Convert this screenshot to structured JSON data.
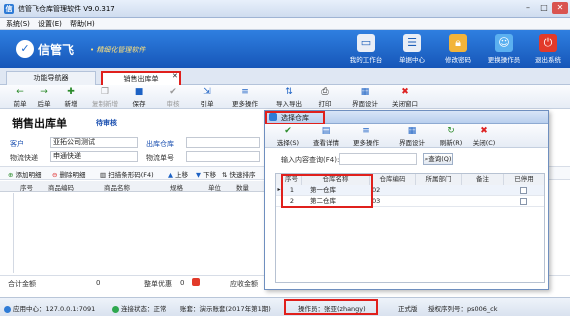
{
  "window": {
    "title": "信管飞仓库管理软件 V9.0.317"
  },
  "menu": [
    "系统(S)",
    "设置(E)",
    "帮助(H)"
  ],
  "banner": {
    "logo_text": "信管飞",
    "slogan": "• 精细化管理软件",
    "buttons": [
      {
        "label": "我的工作台",
        "icon": "monitor-icon",
        "color": "#e9eef6"
      },
      {
        "label": "单据中心",
        "icon": "document-center-icon",
        "color": "#e9eef6"
      },
      {
        "label": "修改密码",
        "icon": "lock-icon",
        "color": "#f2b43a"
      },
      {
        "label": "更换操作员",
        "icon": "user-switch-icon",
        "color": "#5bb0f0"
      },
      {
        "label": "退出系统",
        "icon": "power-icon",
        "color": "#e23a2a"
      }
    ]
  },
  "tabs": [
    {
      "label": "功能导航器"
    },
    {
      "label": "销售出库单"
    }
  ],
  "toolbar": [
    {
      "label": "前单",
      "icon": "←",
      "enabled": true
    },
    {
      "label": "后单",
      "icon": "→",
      "enabled": true
    },
    {
      "label": "新增",
      "icon": "✚",
      "enabled": true
    },
    {
      "label": "复制新增",
      "icon": "❐",
      "enabled": false
    },
    {
      "label": "保存",
      "icon": "■",
      "enabled": true
    },
    {
      "label": "审核",
      "icon": "✔",
      "enabled": false
    },
    {
      "label": "引单",
      "icon": "⇲",
      "enabled": true
    },
    {
      "label": "更多操作",
      "icon": "≡",
      "enabled": true
    },
    {
      "label": "导入导出",
      "icon": "⇅",
      "enabled": true
    },
    {
      "label": "打印",
      "icon": "⎙",
      "enabled": true
    },
    {
      "label": "界面设计",
      "icon": "▦",
      "enabled": true
    },
    {
      "label": "关闭窗口",
      "icon": "✖",
      "enabled": true
    }
  ],
  "document": {
    "title": "销售出库单",
    "status": "待审核",
    "customer_label": "客户",
    "customer_value": "亚拓公司测试",
    "warehouse_label": "出库仓库",
    "logistics_label": "物流快递",
    "logistics_value": "申通快递",
    "tracking_label": "物流单号",
    "subtoolbar": [
      "添加明细",
      "删除明细",
      "扫描条形码(F4)",
      "上移",
      "下移",
      "快速排序"
    ],
    "grid_headers": [
      "序号",
      "商品编码",
      "商品名称",
      "规格",
      "单位",
      "数量"
    ],
    "total_amount_label": "合计金额",
    "total_amount_value": "0",
    "discount_label": "整单优惠",
    "discount_value": "0",
    "receivable_label": "应收金额"
  },
  "dialog": {
    "title": "选择仓库",
    "toolbar": [
      "选择(S)",
      "查看详情",
      "更多操作",
      "界面设计",
      "刷新(R)",
      "关闭(C)"
    ],
    "search_label": "输入内容查询(F4):",
    "search_value": "",
    "search_button": "查询(Q)",
    "columns": [
      "序号",
      "仓库名称",
      "仓库编码",
      "所属部门",
      "备注",
      "已停用"
    ],
    "rows": [
      {
        "index": "1",
        "name": "第一仓库",
        "code": "02",
        "dept": "",
        "note": ""
      },
      {
        "index": "2",
        "name": "第二仓库",
        "code": "03",
        "dept": "",
        "note": ""
      }
    ]
  },
  "statusbar": {
    "app_center": "应用中心：127.0.0.1:7091",
    "connection": "连接状态：正常",
    "account": "账套：演示账套(2017年第1期)",
    "operator": "操作员：张亚(zhangy)",
    "edition": "正式版",
    "license": "授权序列号：ps006_ck"
  }
}
